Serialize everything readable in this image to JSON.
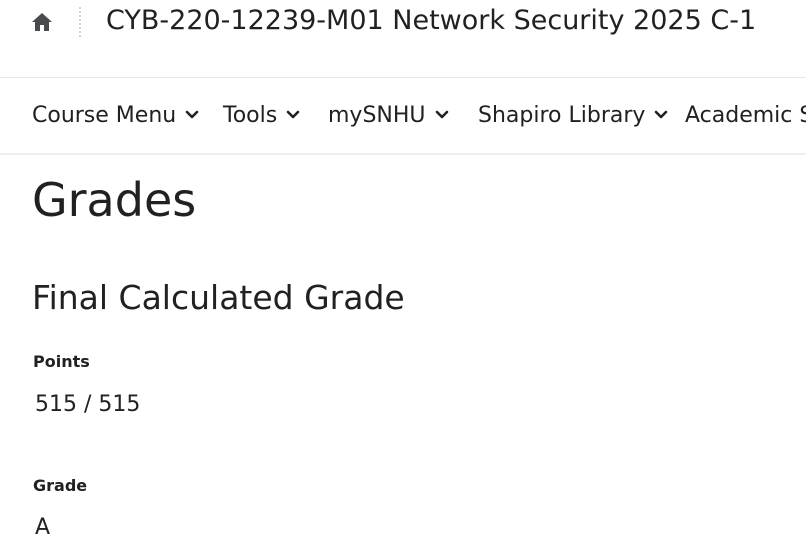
{
  "header": {
    "home_icon": "home-icon",
    "course_title": "CYB-220-12239-M01 Network Security 2025 C-1"
  },
  "nav": {
    "items": [
      {
        "label": "Course Menu",
        "icon": "chevron-down-icon"
      },
      {
        "label": "Tools",
        "icon": "chevron-down-icon"
      },
      {
        "label": "mySNHU",
        "icon": "chevron-down-icon"
      },
      {
        "label": "Shapiro Library",
        "icon": "chevron-down-icon"
      },
      {
        "label": "Academic Support",
        "icon": "chevron-down-icon"
      }
    ]
  },
  "main": {
    "page_title": "Grades",
    "section_title": "Final Calculated Grade",
    "points": {
      "label": "Points",
      "value": "515 / 515"
    },
    "grade": {
      "label": "Grade",
      "value": "A"
    }
  }
}
